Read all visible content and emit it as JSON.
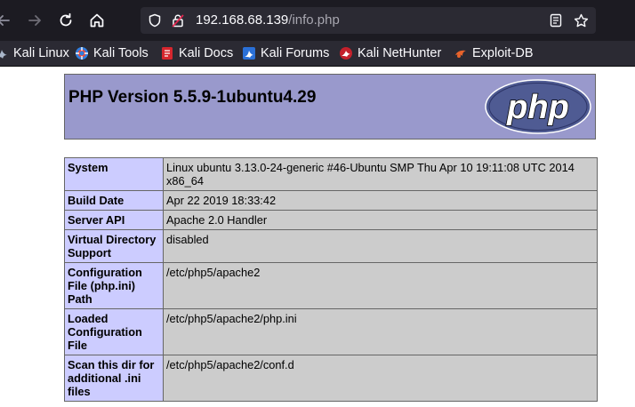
{
  "browser": {
    "url_host": "192.168.68.139",
    "url_path": "/info.php",
    "bookmarks": [
      {
        "label": "Kali Linux",
        "icon": "kali-dragon-icon"
      },
      {
        "label": "Kali Tools",
        "icon": "kali-tools-icon"
      },
      {
        "label": "Kali Docs",
        "icon": "kali-docs-icon"
      },
      {
        "label": "Kali Forums",
        "icon": "kali-forums-icon"
      },
      {
        "label": "Kali NetHunter",
        "icon": "kali-nethunter-icon"
      },
      {
        "label": "Exploit-DB",
        "icon": "exploit-db-icon"
      }
    ]
  },
  "page": {
    "title": "PHP Version 5.5.9-1ubuntu4.29",
    "logo_text": "php",
    "rows": [
      {
        "key": "System",
        "value": "Linux ubuntu 3.13.0-24-generic #46-Ubuntu SMP Thu Apr 10 19:11:08 UTC 2014 x86_64"
      },
      {
        "key": "Build Date",
        "value": "Apr 22 2019 18:33:42"
      },
      {
        "key": "Server API",
        "value": "Apache 2.0 Handler"
      },
      {
        "key": "Virtual Directory Support",
        "value": "disabled"
      },
      {
        "key": "Configuration File (php.ini) Path",
        "value": "/etc/php5/apache2"
      },
      {
        "key": "Loaded Configuration File",
        "value": "/etc/php5/apache2/php.ini"
      },
      {
        "key": "Scan this dir for additional .ini files",
        "value": "/etc/php5/apache2/conf.d"
      }
    ]
  },
  "colors": {
    "header_bg": "#9999cc",
    "key_cell_bg": "#ccccff",
    "value_cell_bg": "#cccccc",
    "toolbar_bg": "#1c1b22"
  }
}
